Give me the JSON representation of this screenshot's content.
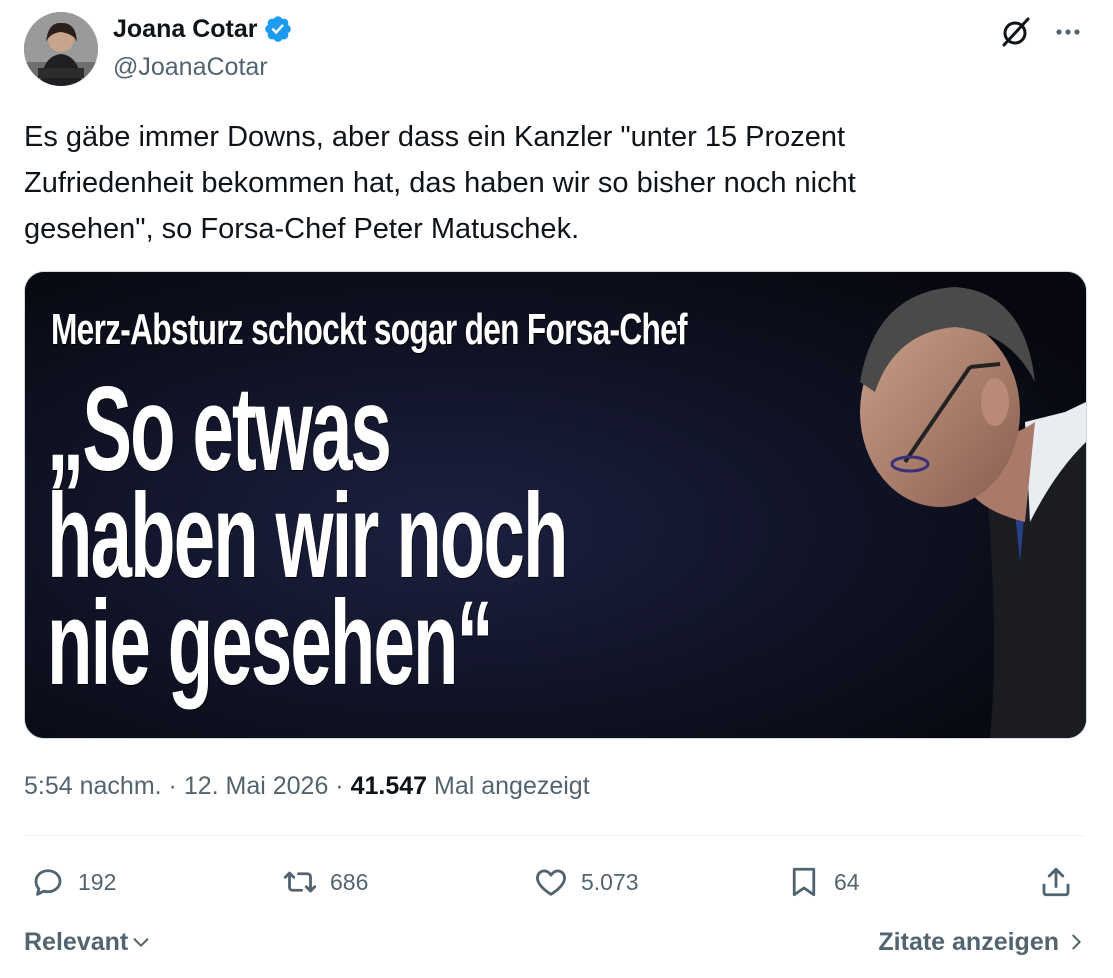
{
  "author": {
    "name": "Joana Cotar",
    "handle": "@JoanaCotar",
    "verified": true
  },
  "tweet": {
    "text": "Es gäbe immer Downs, aber dass ein Kanzler \"unter 15 Prozent\nZufriedenheit bekommen hat, das haben wir so bisher noch nicht\ngesehen\", so Forsa-Chef Peter Matuschek."
  },
  "media": {
    "headline_sub": "Merz-Absturz schockt sogar den Forsa-Chef",
    "headline_main": "„So etwas\nhaben wir noch\nnie gesehen“"
  },
  "meta": {
    "time": "5:54 nachm.",
    "separator": " · ",
    "date": "12. Mai 2026",
    "views_count": "41.547",
    "views_label": "Mal angezeigt"
  },
  "actions": {
    "replies": "192",
    "reposts": "686",
    "likes": "5.073",
    "bookmarks": "64"
  },
  "footer": {
    "sort_label": "Relevant",
    "quotes_label": "Zitate anzeigen"
  },
  "colors": {
    "verified": "#1d9bf0",
    "text_primary": "#0f1419",
    "text_secondary": "#536471"
  },
  "icons": [
    "verified-badge-icon",
    "grok-icon",
    "more-icon",
    "reply-icon",
    "repost-icon",
    "like-icon",
    "bookmark-icon",
    "share-icon",
    "chevron-down-icon",
    "chevron-right-icon"
  ]
}
